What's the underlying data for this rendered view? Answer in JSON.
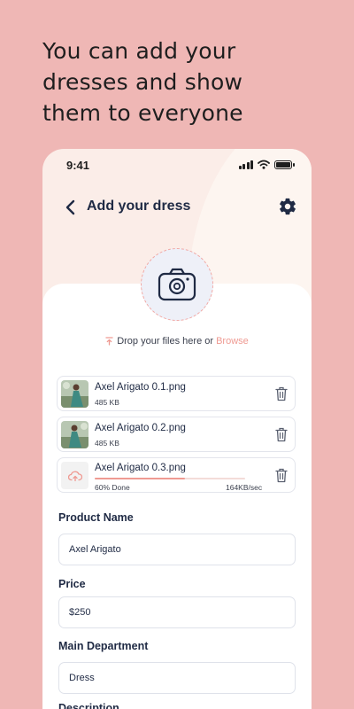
{
  "headline": "You can add your\ndresses and show\nthem to everyone",
  "status_bar": {
    "time": "9:41"
  },
  "header": {
    "title": "Add your dress"
  },
  "upload": {
    "drop_text": "Drop your files here or ",
    "browse_label": "Browse"
  },
  "files": [
    {
      "name": "Axel Arigato 0.1.png",
      "size": "485 KB"
    },
    {
      "name": "Axel Arigato 0.2.png",
      "size": "485 KB"
    },
    {
      "name": "Axel Arigato 0.3.png",
      "progress_label": "60% Done",
      "speed": "164KB/sec",
      "progress": 0.6
    }
  ],
  "form": {
    "product_name": {
      "label": "Product Name",
      "value": "Axel Arigato"
    },
    "price": {
      "label": "Price",
      "value": "$250"
    },
    "department": {
      "label": "Main Department",
      "value": "Dress"
    },
    "description": {
      "label": "Description"
    }
  },
  "colors": {
    "background": "#efb7b5",
    "accent": "#ef9a92",
    "text_dark": "#1f2a44"
  },
  "icons": [
    "back-arrow-icon",
    "gear-icon",
    "camera-icon",
    "upload-icon",
    "trash-icon",
    "cloud-upload-icon"
  ]
}
